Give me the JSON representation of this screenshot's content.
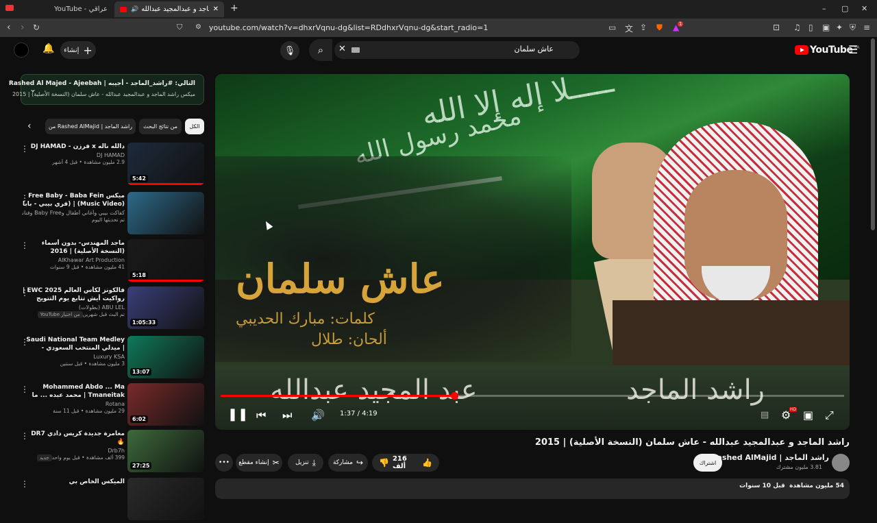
{
  "browser": {
    "tabs": [
      {
        "label": "YouTube - عراقي",
        "active": false
      },
      {
        "label": "راشد الماجد و عبدالمجيد عبدالله",
        "active": true
      }
    ],
    "new_tab": "+",
    "window_controls": {
      "min": "–",
      "max": "▢",
      "close": "✕"
    },
    "url": "youtube.com/watch?v=dhxrVqnu-dg&list=RDdhxrVqnu-dg&start_radio=1",
    "extension_badge": "1"
  },
  "header": {
    "create_label": "إنشاء",
    "search_query": "عاش سلمان",
    "logo_text": "YouTube",
    "logo_region": "SA"
  },
  "player": {
    "art_title": "عاش سلمان",
    "art_lyrics": "كلمات: مبارك الحديبي",
    "art_music": "ألحان: طلال",
    "band_left": "عبد المجيد عبدالله",
    "band_right": "راشد الماجد",
    "time": "1:37 / 4:19",
    "progress_fraction": 0.375,
    "hd_badge": "HD"
  },
  "video": {
    "title": "راشد الماجد و عبدالمجيد عبدالله - عاش سلمان (النسخة الأصلية) | 2015",
    "channel": "راشد الماجد | Rashed AlMajid",
    "subscribers": "3.81 مليون مشترك",
    "subscribe_label": "اشتراك",
    "likes": "216 ألف",
    "share_label": "مشاركة",
    "download_label": "تنزيل",
    "clip_label": "إنشاء مقطع",
    "more_label": "•••",
    "views": "54 مليون مشاهدة",
    "age": "قبل 10 سنوات"
  },
  "sidebar": {
    "next_up_title": "التالي: #راشد_الماجد - أجيبه | Rashed Al Majed - Ajeebah",
    "next_up_sub": "ميكس راشد الماجد و عبدالمجيد عبدالله - عاش سلمان (النسخة الأصلية) | 2015",
    "chips": [
      "الكل",
      "من نتائج البحث",
      "من Rashed AlMajid | راشد الماجد"
    ],
    "items": [
      {
        "title": "دالله ناله x فرزن - DJ HAMAD",
        "channel": "DJ HAMAD",
        "stats": "2.9 مليون مشاهدة • قبل 4 أشهر",
        "duration": "5:42",
        "color": "#1d2a3c",
        "badge": ""
      },
      {
        "title": "ميكس Free Baby - Baba Fein (Music Video) | (فري بيبي - بابا فين ...",
        "channel": "كفاكت بيبي وأغاني أطفال وBaby Free وفنانون آخرون",
        "stats": "تم تحديثها اليوم",
        "duration": "",
        "color": "#2d6a8a",
        "badge": ""
      },
      {
        "title": "ماجد المهندس- بدون أسماء (النسخة الأصلية) | 2016",
        "channel": "AlKhawar Art Production",
        "stats": "41 مليون مشاهدة • قبل 9 سنوات",
        "duration": "5:18",
        "color": "#1a1a1a",
        "badge": ""
      },
      {
        "title": "فالكونز لكأس العالم EWC 2025 | رواكيت أيش تتابع يوم التتويج لكأس العالم",
        "channel": "ABU LEL (بطولات)",
        "stats": "تم البث قبل شهرين",
        "duration": "1:05:33",
        "color": "#3a3f7a",
        "badge": "من اختيار YouTube"
      },
      {
        "title": "Saudi National Team Medley | ميدلي المنتخب السعودي - (حصريا) | ...",
        "channel": "Luxury KSA",
        "stats": "3 مليون مشاهدة • قبل سنتين",
        "duration": "13:07",
        "color": "#0f7a5a",
        "badge": ""
      },
      {
        "title": "Mohammed Abdo ... Ma Tmaneitak | محمد عبده ... ما تمنيتك",
        "channel": "Rotana",
        "stats": "29 مليون مشاهدة • قبل 11 سنة",
        "duration": "6:02",
        "color": "#7a2a2a",
        "badge": ""
      },
      {
        "title": "مغامرة جديدة كريس دادي DR7 🔥",
        "channel": "Drb7h",
        "stats": "399 ألف مشاهدة • قبل يوم واحد",
        "duration": "27:25",
        "color": "#3d6a3a",
        "badge": "جديد"
      },
      {
        "title": "الميكس الخاص بي",
        "channel": "",
        "stats": "",
        "duration": "",
        "color": "#2a2a2a",
        "badge": ""
      }
    ]
  },
  "colors": {
    "accent": "#ff0000",
    "bg": "#0f0f0f",
    "surface": "#272727"
  }
}
